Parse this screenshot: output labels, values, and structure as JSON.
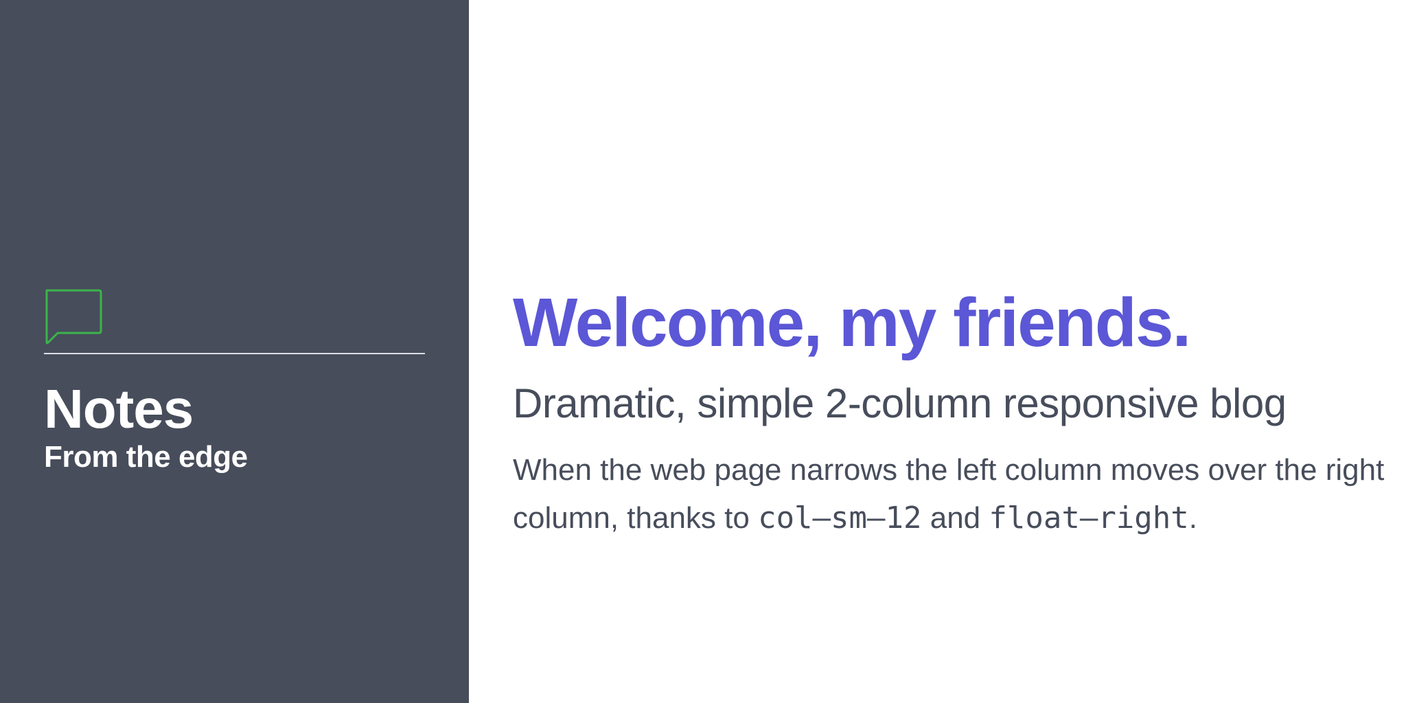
{
  "sidebar": {
    "icon": "speech-bubble-icon",
    "title": "Notes",
    "subtitle": "From the edge",
    "background_color": "#474d5b",
    "icon_color": "#3bb54a"
  },
  "main": {
    "heading": "Welcome, my friends.",
    "heading_color": "#5b57d6",
    "subheading": "Dramatic, simple 2-column responsive blog",
    "body": {
      "text_1": "When the web page narrows the left column moves over the right column, thanks to ",
      "code_1": "col–sm–12",
      "text_2": " and ",
      "code_2": "float–right",
      "text_3": "."
    },
    "text_color": "#474d5b"
  }
}
